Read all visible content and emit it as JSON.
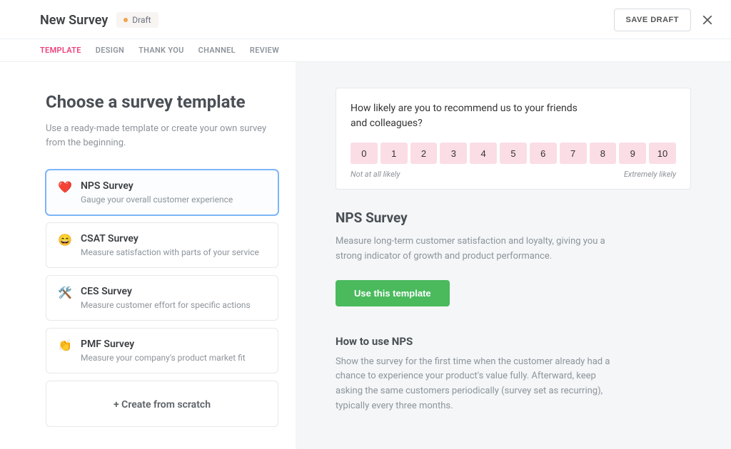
{
  "header": {
    "title": "New Survey",
    "badge": "Draft",
    "save_label": "SAVE DRAFT"
  },
  "tabs": [
    {
      "label": "TEMPLATE",
      "active": true
    },
    {
      "label": "DESIGN",
      "active": false
    },
    {
      "label": "THANK YOU",
      "active": false
    },
    {
      "label": "CHANNEL",
      "active": false
    },
    {
      "label": "REVIEW",
      "active": false
    }
  ],
  "left": {
    "heading": "Choose a survey template",
    "sub": "Use a ready-made template or create your own survey from the beginning.",
    "templates": [
      {
        "icon": "❤️",
        "title": "NPS Survey",
        "desc": "Gauge your overall customer experience",
        "selected": true
      },
      {
        "icon": "😄",
        "title": "CSAT Survey",
        "desc": "Measure satisfaction with parts of your service",
        "selected": false
      },
      {
        "icon": "🛠️",
        "title": "CES Survey",
        "desc": "Measure customer effort for specific actions",
        "selected": false
      },
      {
        "icon": "👏",
        "title": "PMF Survey",
        "desc": "Measure your company's product market fit",
        "selected": false
      }
    ],
    "create_label": "+ Create from scratch"
  },
  "right": {
    "preview": {
      "question": "How likely are you to recommend us to your friends and colleagues?",
      "scale": [
        "0",
        "1",
        "2",
        "3",
        "4",
        "5",
        "6",
        "7",
        "8",
        "9",
        "10"
      ],
      "low_label": "Not at all likely",
      "high_label": "Extremely likely"
    },
    "title": "NPS Survey",
    "body": "Measure long-term customer satisfaction and loyalty, giving you a strong indicator of growth and product performance.",
    "cta": "Use this template",
    "howto_title": "How to use NPS",
    "howto_body": "Show the survey for the first time when the customer already had a chance to experience your product's value fully. Afterward, keep asking the same customers periodically (survey set as recurring), typically every three months."
  }
}
